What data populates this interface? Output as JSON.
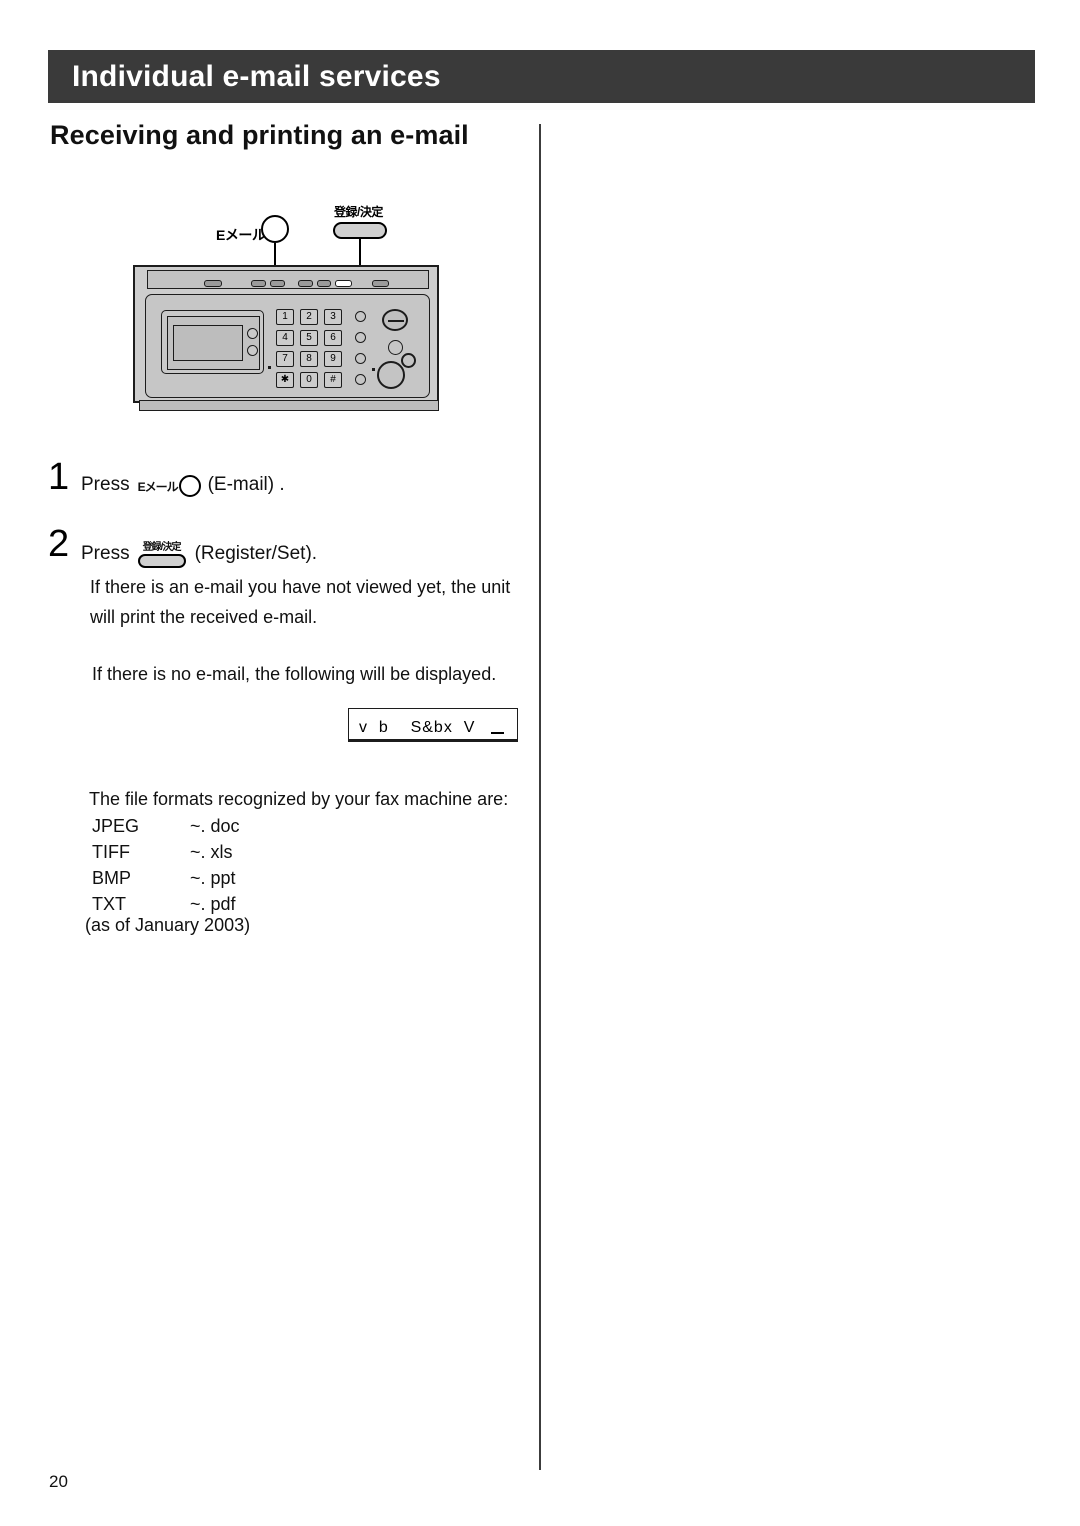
{
  "header": {
    "title": "Individual e-mail services"
  },
  "section": {
    "heading": "Receiving and printing an e-mail"
  },
  "figure": {
    "name": "fax-machine-control-panel",
    "callouts": [
      {
        "label_jp": "Eメール",
        "label_en": "E-mail"
      },
      {
        "label_jp": "登録/決定",
        "label_en": "Register/Set"
      }
    ],
    "keypad_keys": [
      "1",
      "2",
      "3",
      "4",
      "5",
      "6",
      "7",
      "8",
      "9",
      "✱",
      "0",
      "#"
    ]
  },
  "steps": [
    {
      "number": "1",
      "press_word": "Press",
      "key_jp": "Eメール",
      "key_caption": "(E-mail) .",
      "body": []
    },
    {
      "number": "2",
      "press_word": "Press",
      "key_jp": "登録/決定",
      "key_caption": "(Register/Set).",
      "body": [
        "If there is an e-mail you have not viewed yet, the unit will print the received e-mail.",
        "If there is no e-mail, the following will be displayed."
      ]
    }
  ],
  "lcd_display": {
    "text": "v  b    S&bx  V",
    "cursor": "_"
  },
  "formats": {
    "intro": "The file formats recognized by your fax machine are:",
    "rows": [
      {
        "name": "JPEG",
        "ext": "~. doc"
      },
      {
        "name": "TIFF",
        "ext": "~. xls"
      },
      {
        "name": "BMP",
        "ext": "~. ppt"
      },
      {
        "name": "TXT",
        "ext": "~. pdf"
      }
    ],
    "as_of": "(as of January 2003)"
  },
  "footer": {
    "page_number": "20"
  },
  "colors": {
    "header_bg": "#3a3a3a",
    "header_text": "#ffffff",
    "body_text": "#111111",
    "device_body": "#cdcdcd",
    "rule": "#3c3c3c"
  }
}
